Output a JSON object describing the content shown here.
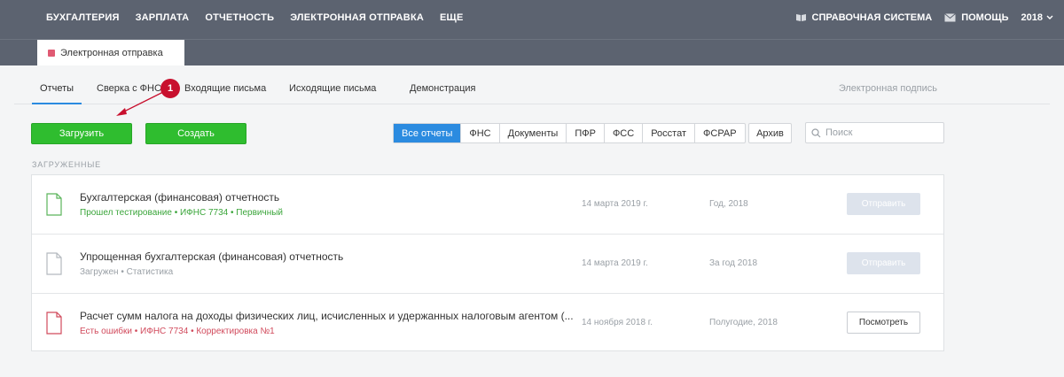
{
  "topnav": {
    "items": [
      "БУХГАЛТЕРИЯ",
      "ЗАРПЛАТА",
      "ОТЧЕТНОСТЬ",
      "ЭЛЕКТРОННАЯ ОТПРАВКА",
      "ЕЩЕ"
    ],
    "help_system": "СПРАВОЧНАЯ СИСТЕМА",
    "help": "ПОМОЩЬ",
    "year": "2018"
  },
  "section_tab": {
    "label": "Электронная отправка",
    "color": "#e05a73"
  },
  "tabs": [
    {
      "label": "Отчеты",
      "active": true
    },
    {
      "label": "Сверка с ФНС",
      "active": false
    },
    {
      "label": "Входящие письма",
      "active": false
    },
    {
      "label": "Исходящие письма",
      "active": false
    },
    {
      "label": "Демонстрация",
      "active": false
    }
  ],
  "signature_link": "Электронная подпись",
  "actions": {
    "upload": "Загрузить",
    "create": "Создать"
  },
  "filters": [
    "Все отчеты",
    "ФНС",
    "Документы",
    "ПФР",
    "ФСС",
    "Росстат",
    "ФСРАР"
  ],
  "active_filter": "Все отчеты",
  "archive": "Архив",
  "search": {
    "placeholder": "Поиск",
    "value": ""
  },
  "group_label": "ЗАГРУЖЕННЫЕ",
  "rows": [
    {
      "title": "Бухгалтерская (финансовая) отчетность",
      "subtitle": "Прошел тестирование • ИФНС 7734 • Первичный",
      "status": "ok",
      "date": "14 марта 2019 г.",
      "period": "Год, 2018",
      "action": "Отправить",
      "action_enabled": false
    },
    {
      "title": "Упрощенная бухгалтерская (финансовая) отчетность",
      "subtitle": "Загружен • Статистика",
      "status": "neutral",
      "date": "14 марта 2019 г.",
      "period": "За год 2018",
      "action": "Отправить",
      "action_enabled": false
    },
    {
      "title": "Расчет сумм налога на доходы физических лиц, исчисленных и удержанных налоговым агентом (...",
      "subtitle": "Есть ошибки • ИФНС 7734 • Корректировка №1",
      "status": "error",
      "date": "14 ноября 2018 г.",
      "period": "Полугодие, 2018",
      "action": "Посмотреть",
      "action_enabled": true
    }
  ],
  "annotation": {
    "number": "1"
  },
  "colors": {
    "topbar": "#5c6370",
    "accent": "#2b8be0",
    "green": "#2fbd2f",
    "error": "#d14a5c",
    "ok": "#3aa53a",
    "marker": "#c8102e"
  }
}
